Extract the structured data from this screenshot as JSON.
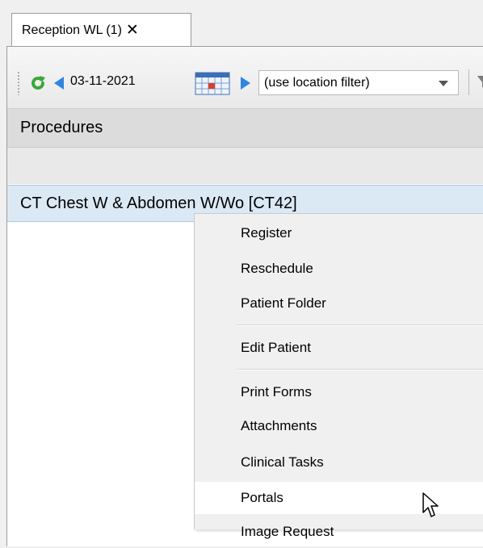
{
  "tab": {
    "label": "Reception WL (1)",
    "close": "✕"
  },
  "toolbar": {
    "date": "03-11-2021",
    "location_select": "(use location filter)",
    "icons": [
      "grip-icon",
      "refresh-icon",
      "prev-arrow-icon",
      "calendar-icon",
      "next-arrow-icon",
      "dropdown-caret-icon",
      "filter-icon"
    ]
  },
  "grid": {
    "header": "Procedures",
    "row": "CT Chest W & Abdomen W/Wo [CT42]"
  },
  "context_menu": {
    "items": [
      "Register",
      "Reschedule",
      "Patient Folder",
      "Edit Patient",
      "Print Forms",
      "Attachments",
      "Clinical Tasks",
      "Portals",
      "Image Request"
    ],
    "highlighted": "Portals"
  },
  "colors": {
    "accent_blue": "#2f86e0",
    "refresh_green": "#3aa83a",
    "selection": "#dbe9f5"
  }
}
